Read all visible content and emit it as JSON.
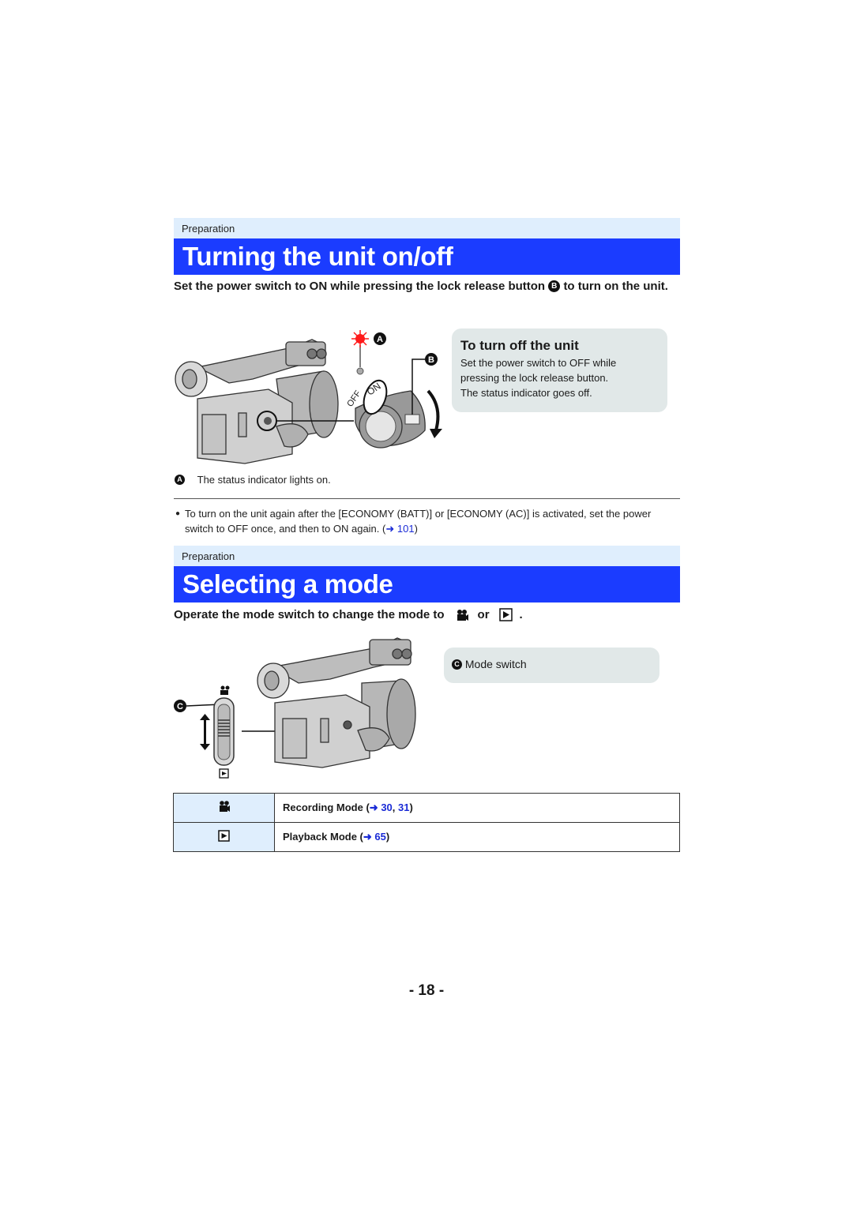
{
  "section1": {
    "category": "Preparation",
    "title": "Turning the unit on/off",
    "lead_part1": "Set the power switch to ON while pressing the lock release button",
    "lead_marker": "B",
    "lead_part2": "to turn on the unit.",
    "figure": {
      "marker_a": "A",
      "marker_b": "B",
      "switch_on_label": "ON",
      "switch_off_label": "OFF",
      "indicator_color": "#ff1a1a"
    },
    "callout": {
      "title": "To turn off the unit",
      "body_lines": [
        "Set the power switch to OFF while",
        "pressing the lock release button.",
        "The status indicator goes off."
      ]
    },
    "caption_marker": "A",
    "caption": "The status indicator lights on.",
    "note": {
      "bullet": "●",
      "text": "To turn on the unit again after the [ECONOMY (BATT)] or [ECONOMY (AC)] is activated, set the power switch to OFF once, and then to ON again. (",
      "arrow": "➜",
      "link": "101",
      "close": ")"
    }
  },
  "section2": {
    "category": "Preparation",
    "title": "Selecting a mode",
    "lead_part1": "Operate the mode switch to change the mode to",
    "lead_or": "or",
    "lead_end": ".",
    "figure": {
      "marker_c": "C"
    },
    "callout": {
      "marker": "C",
      "text": "Mode switch"
    },
    "table": {
      "rows": [
        {
          "icon": "movie-camera-icon",
          "label": "Recording Mode (",
          "arrow": "➜",
          "links": [
            "30",
            "31"
          ],
          "close": ")"
        },
        {
          "icon": "play-icon",
          "label": "Playback Mode (",
          "arrow": "➜",
          "links": [
            "65"
          ],
          "close": ")"
        }
      ]
    }
  },
  "page_number": "- 18 -",
  "colors": {
    "title_bar": "#1b3cff",
    "category_bar": "#dfeefd",
    "callout_bg": "#e1e8e8",
    "link": "#1a2bd6"
  }
}
